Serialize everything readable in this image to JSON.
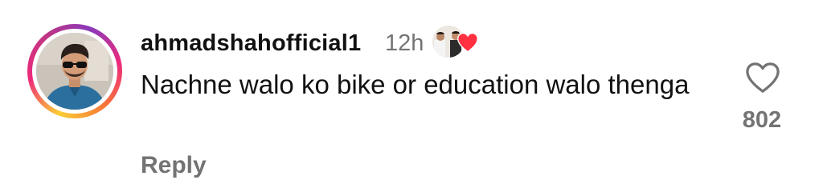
{
  "comment": {
    "username": "ahmadshahofficial1",
    "time": "12h",
    "text": "Nachne walo ko bike or education walo thenga",
    "reply_label": "Reply",
    "like_count": "802",
    "liked_by_creator": true,
    "icons": {
      "like": "heart-outline-icon",
      "creator_like": "red-heart-icon"
    },
    "colors": {
      "heart_red": "#ff3040",
      "secondary_text": "#737373",
      "primary_text": "#111111"
    }
  }
}
